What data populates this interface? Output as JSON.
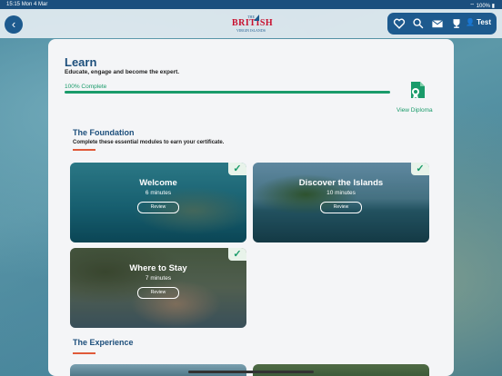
{
  "status": {
    "time": "15:15",
    "date": "Mon 4 Mar",
    "battery": "100%"
  },
  "header": {
    "logo": {
      "small_top": "THE",
      "big": "BRITISH",
      "small_bottom": "VIRGIN ISLANDS"
    },
    "user_label": "Test"
  },
  "learn": {
    "title": "Learn",
    "subtitle": "Educate, engage and become the expert.",
    "progress_label": "100% Complete",
    "progress": 1.0,
    "diploma_label": "View Diploma"
  },
  "foundation": {
    "title": "The Foundation",
    "subtitle": "Complete these essential modules to earn your certificate.",
    "modules": [
      {
        "title": "Welcome",
        "duration": "6 minutes",
        "action": "Review"
      },
      {
        "title": "Discover the Islands",
        "duration": "10 minutes",
        "action": "Review"
      },
      {
        "title": "Where to Stay",
        "duration": "7 minutes",
        "action": "Review"
      }
    ]
  },
  "experience": {
    "title": "The Experience"
  },
  "colors": {
    "brand_blue": "#1d5a8e",
    "accent_green": "#1a9b6a",
    "accent_red": "#e05a3a"
  }
}
